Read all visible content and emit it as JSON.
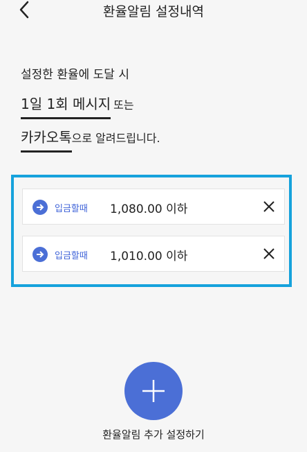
{
  "header": {
    "title": "환율알림 설정내역"
  },
  "intro": {
    "line1": "설정한 환율에 도달 시",
    "line2_highlight": "1일 1회 메시지",
    "line2_suffix": "또는",
    "line3_highlight": "카카오톡",
    "line3_suffix": "으로 알려드립니다."
  },
  "alerts": [
    {
      "tag": "입금할때",
      "value": "1,080.00 이하"
    },
    {
      "tag": "입금할때",
      "value": "1,010.00 이하"
    }
  ],
  "add_button": {
    "label": "환율알림 추가 설정하기"
  },
  "icons": {
    "back": "chevron-left-icon",
    "arrow": "arrow-right-circle-icon",
    "close": "close-icon",
    "add": "plus-icon"
  },
  "colors": {
    "accent": "#4b6fd6",
    "highlight_border": "#16a2dc"
  }
}
